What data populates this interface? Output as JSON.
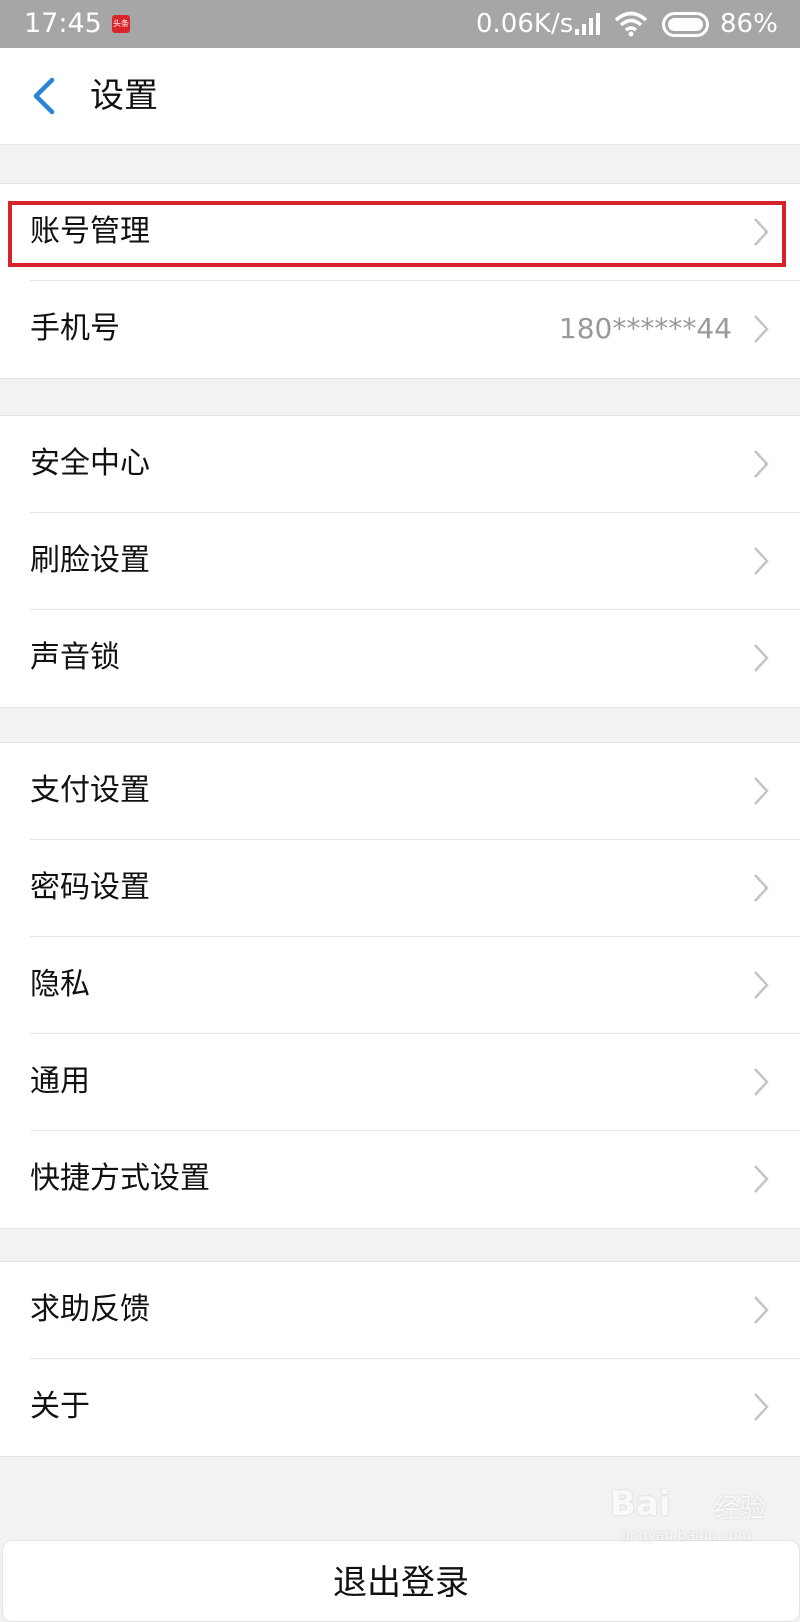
{
  "status_bar": {
    "time": "17:45",
    "app_icon_text": "头条",
    "network_speed": "0.06K/s",
    "battery_percent": "86%"
  },
  "nav": {
    "title": "设置",
    "back_icon": "chevron-left-icon",
    "accent_color": "#2a86d8"
  },
  "groups": [
    {
      "items": [
        {
          "label": "账号管理",
          "highlighted": true
        },
        {
          "label": "手机号",
          "value": "180******44"
        }
      ]
    },
    {
      "items": [
        {
          "label": "安全中心"
        },
        {
          "label": "刷脸设置"
        },
        {
          "label": "声音锁"
        }
      ]
    },
    {
      "items": [
        {
          "label": "支付设置"
        },
        {
          "label": "密码设置"
        },
        {
          "label": "隐私"
        },
        {
          "label": "通用"
        },
        {
          "label": "快捷方式设置"
        }
      ]
    },
    {
      "items": [
        {
          "label": "求助反馈"
        },
        {
          "label": "关于"
        }
      ]
    }
  ],
  "logout_label": "退出登录",
  "highlight_color": "#d6222a",
  "watermark": {
    "brand": "Bai",
    "brand_suffix": "经验",
    "url": "jingyan.baidu.com"
  }
}
